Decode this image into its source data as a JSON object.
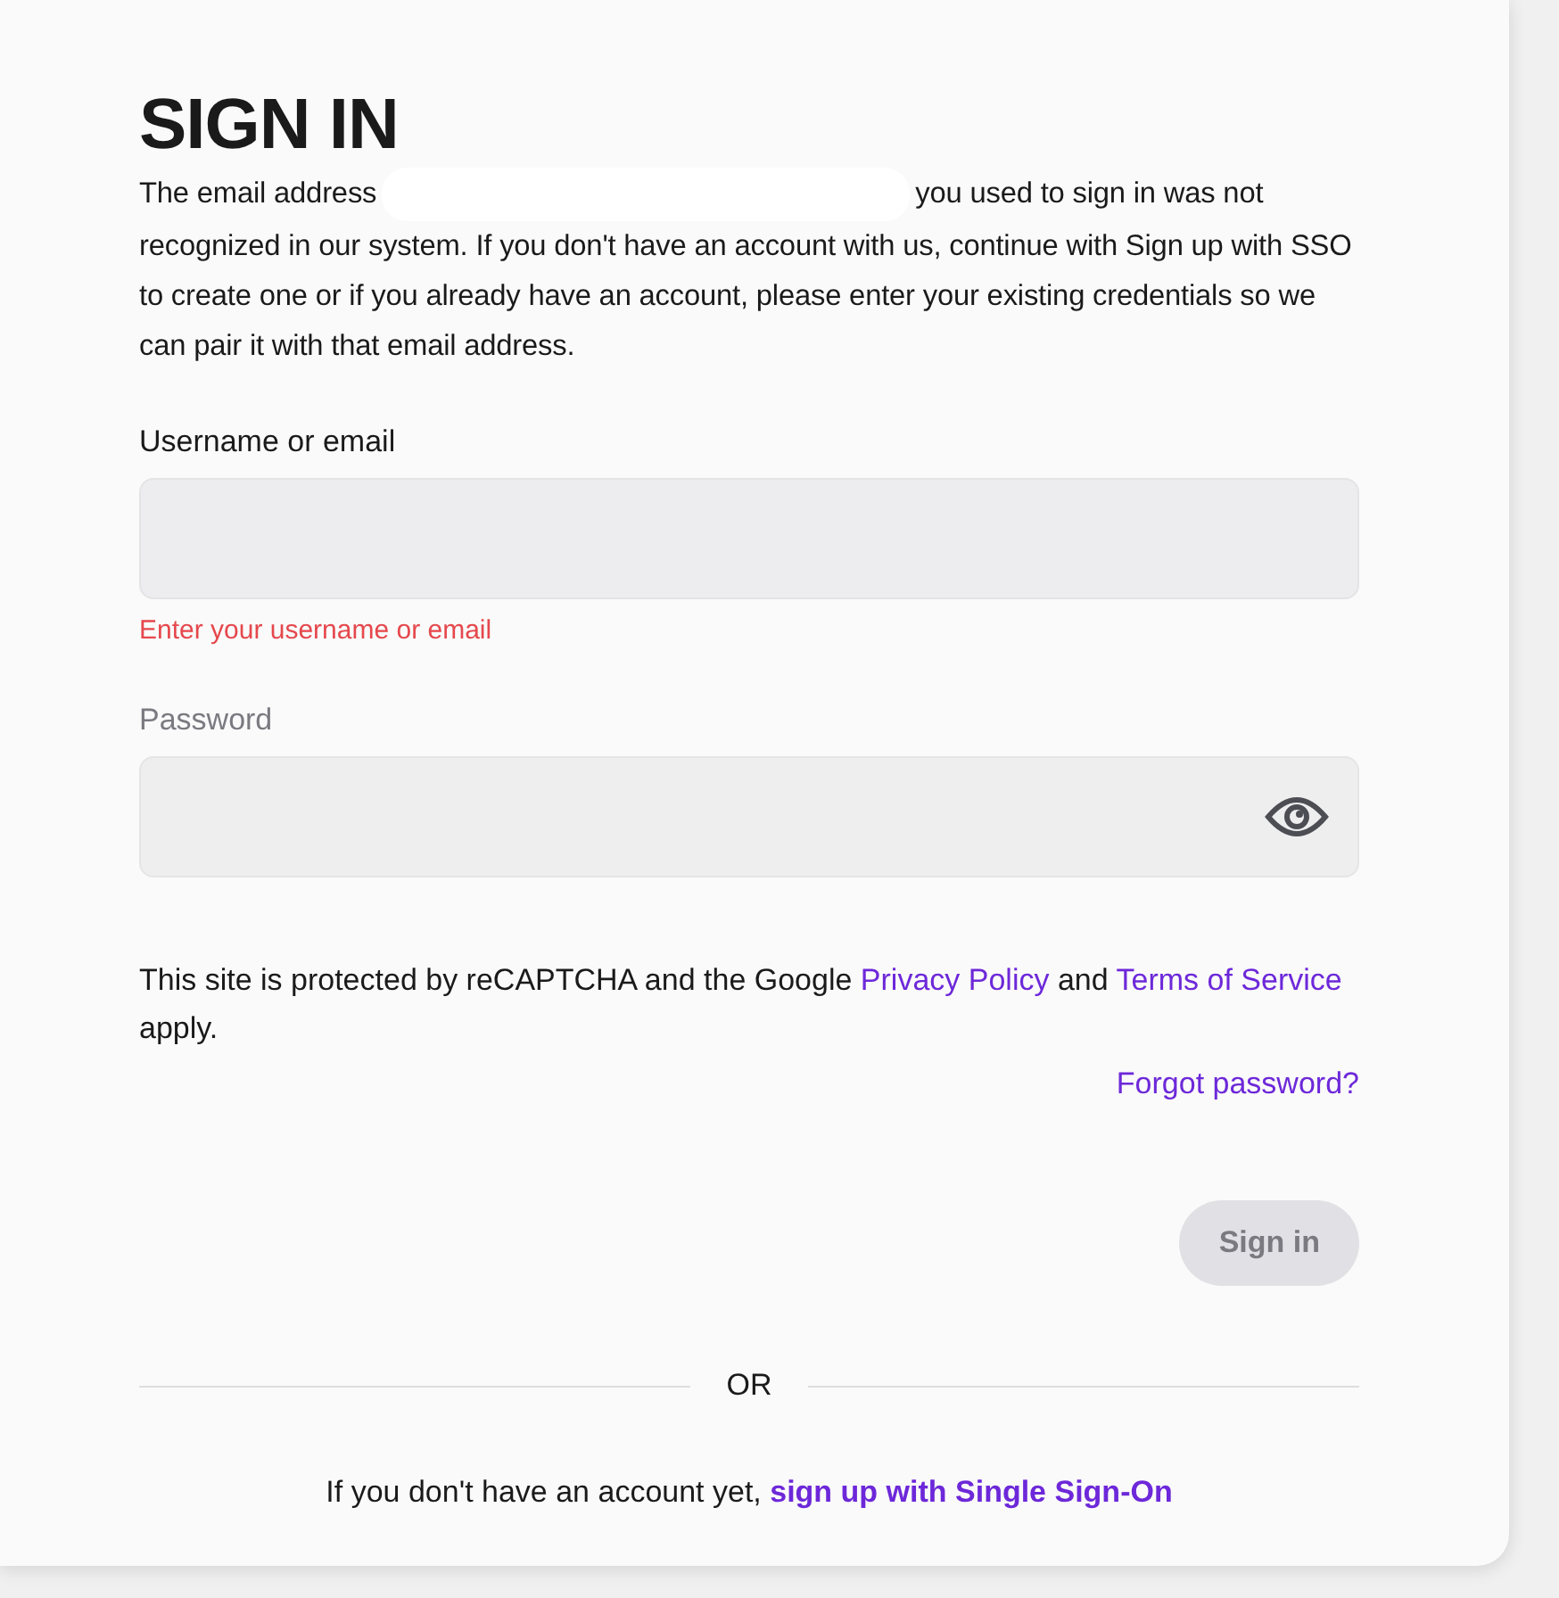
{
  "title": "SIGN IN",
  "notice": {
    "before": "The email address",
    "after": "you used to sign in was not recognized in our system. If you don't have an account with us, continue with Sign up with SSO to create one or if you already have an account, please enter your existing credentials so we can pair it with that email address."
  },
  "fields": [
    {
      "kind": "text",
      "label": "Username or email",
      "disabled": false,
      "error": "Enter your username or email"
    },
    {
      "kind": "password",
      "label": "Password",
      "disabled": true
    }
  ],
  "legal": {
    "text": "This site is protected by reCAPTCHA and the Google",
    "privacy_link": "Privacy Policy",
    "joiner": "and",
    "terms_link": "Terms of Service",
    "tail": "apply."
  },
  "forgot_link": "Forgot password?",
  "submit": {
    "label": "Sign in",
    "disabled": true
  },
  "divider": "OR",
  "footer": {
    "text": "If you don't have an account yet,",
    "link": "sign up with Single Sign-On"
  }
}
